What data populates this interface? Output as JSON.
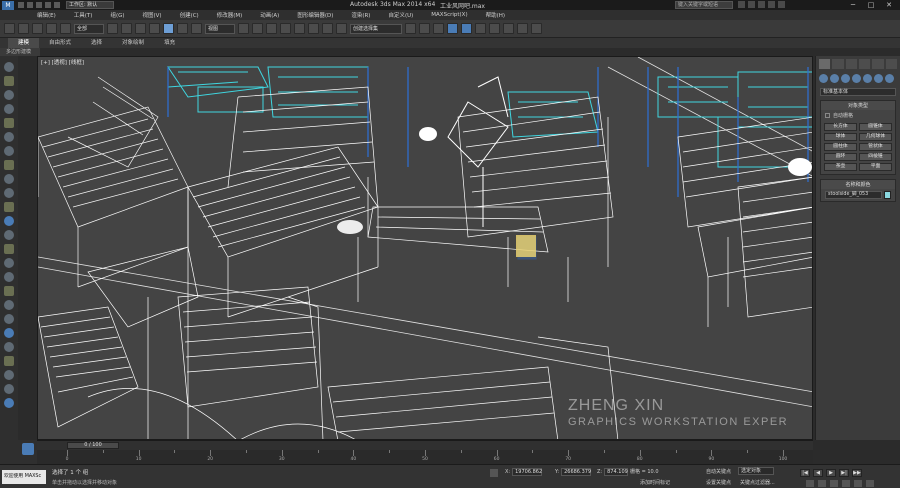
{
  "titlebar": {
    "app_title": "Autodesk 3ds Max  2014 x64",
    "file_name": "工业风网吧.max",
    "workspace": "工作区: 默认",
    "search_placeholder": "键入关键字或短语",
    "app_icon_letter": "M",
    "minimize": "─",
    "maximize": "□",
    "close": "✕"
  },
  "menubar": {
    "items": [
      "编辑(E)",
      "工具(T)",
      "组(G)",
      "视图(V)",
      "创建(C)",
      "修改器(M)",
      "动画(A)",
      "图形编辑器(D)",
      "渲染(R)",
      "自定义(U)",
      "MAXScript(X)",
      "帮助(H)"
    ]
  },
  "toolbar": {
    "selection_filter": "全部",
    "reference_coord": "视图",
    "named_selection": "创建选择集"
  },
  "ribbon": {
    "tabs": [
      "建模",
      "自由形式",
      "选择",
      "对象绘制",
      "填充"
    ],
    "sub_label": "多边形建模"
  },
  "viewport": {
    "label": "[+] [透视] [线框]",
    "watermark_line1": "ZHENG XIN",
    "watermark_line2": "GRAPHICS WORKSTATION EXPER",
    "colors": {
      "background": "#444444",
      "wire_white": "#ffffff",
      "wire_cyan": "#3fd6e0",
      "wire_blue": "#2d6fd6"
    }
  },
  "command_panel": {
    "category_dropdown": "标准基本体",
    "object_type_header": "对象类型",
    "autogrid_label": "自动栅格",
    "buttons": [
      "长方体",
      "圆锥体",
      "球体",
      "几何球体",
      "圆柱体",
      "管状体",
      "圆环",
      "四棱锥",
      "茶壶",
      "平面"
    ],
    "name_color_header": "名称和颜色",
    "object_name": "stoolside_脚_053",
    "object_color": "#8ad8e0"
  },
  "timeline": {
    "slider_label": "0 / 100",
    "ticks": [
      "0",
      "10",
      "20",
      "30",
      "40",
      "50",
      "60",
      "70",
      "80",
      "90",
      "100"
    ]
  },
  "statusbar": {
    "maxscript_label": "欢迎使用 MAXSc",
    "status_main": "选择了 1 个 组",
    "status_hint": "单击并拖动以选择并移动对象",
    "x_label": "X:",
    "x_value": "19706.862",
    "y_label": "Y:",
    "y_value": "26686.379",
    "z_label": "Z:",
    "z_value": "874.109",
    "grid_text": "栅格 = 10.0",
    "add_time_tag": "添加时间标记",
    "auto_key": "自动关键点",
    "selection_set_value": "选定对象",
    "set_key": "设置关键点",
    "key_filter": "关键点过滤器..."
  }
}
